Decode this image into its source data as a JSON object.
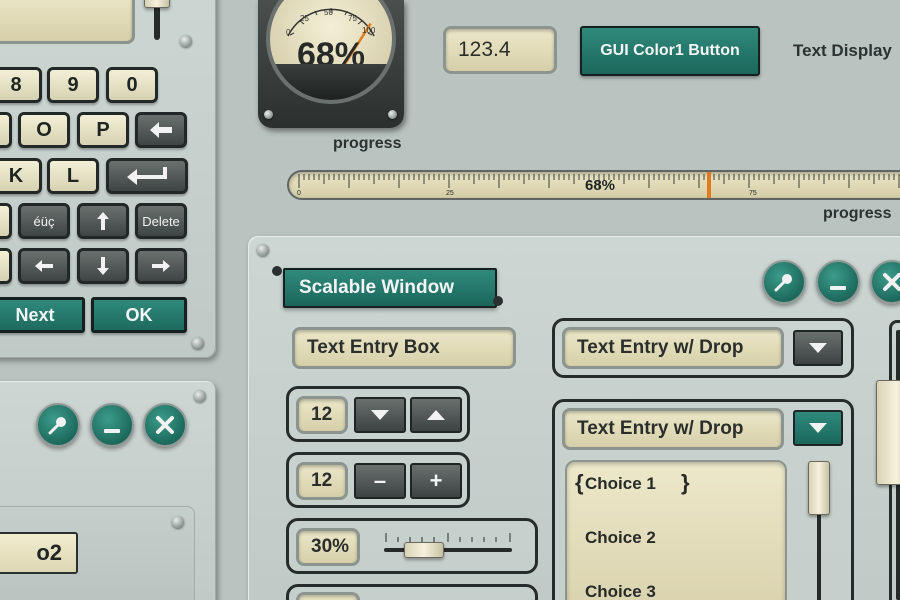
{
  "colors": {
    "background": "#b9c3bf",
    "accent_teal": "#1d6a5e",
    "lcd_cream": "#e4ddbc",
    "dark_key": "#4a504f",
    "gauge_needle": "#e07b1e"
  },
  "keypad": {
    "row1": [
      "8",
      "9",
      "0"
    ],
    "row2": [
      "O",
      "P"
    ],
    "row3": [
      "K",
      "L"
    ],
    "special_key": "éüç",
    "delete_key": "Delete",
    "next_button": "Next",
    "ok_button": "OK",
    "icons": [
      "backspace-icon",
      "enter-icon",
      "arrow-up-icon",
      "arrow-left-icon",
      "arrow-down-icon",
      "arrow-right-icon"
    ]
  },
  "gauge": {
    "value_label": "68%",
    "value": 68,
    "scale_labels": [
      "0",
      "25",
      "50",
      "75",
      "100"
    ],
    "caption": "progress"
  },
  "numeric_display": "123.4",
  "color_button": "GUI Color1 Button",
  "text_display": "Text Display",
  "ruler_progress": {
    "value_label": "68%",
    "value": 68,
    "scale_labels": [
      "0",
      "25",
      "75"
    ],
    "caption": "progress"
  },
  "small_window": {
    "label_fragment": "o2"
  },
  "scalable_window": {
    "title": "Scalable Window",
    "text_entry_placeholder": "Text Entry Box",
    "stepper1_value": "12",
    "stepper2_value": "12",
    "stepper2_minus": "–",
    "stepper2_plus": "+",
    "slider_value_label": "30%",
    "slider_value": 30,
    "dropdown1_value": "Text Entry w/ Drop",
    "dropdown2_value": "Text Entry w/ Drop",
    "choices": [
      "Choice 1",
      "Choice 2",
      "Choice 3"
    ],
    "choice_bracket_left": "{",
    "choice_bracket_right": "}"
  }
}
